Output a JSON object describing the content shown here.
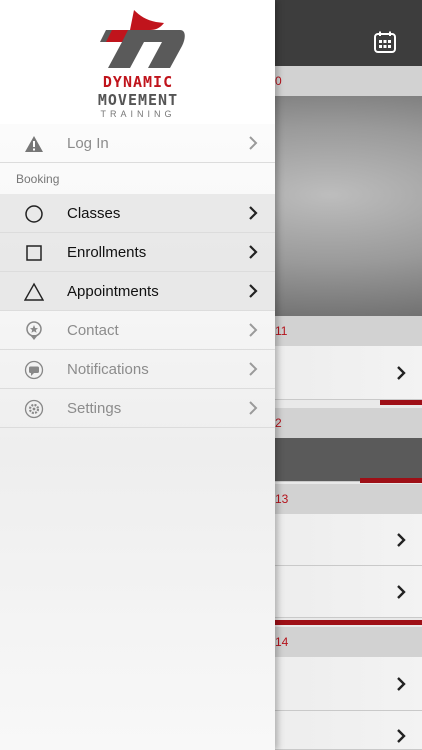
{
  "logo": {
    "line1": "DYNAMIC",
    "line2": "MOVEMENT",
    "line3": "TRAINING",
    "colors": {
      "red": "#c0141c",
      "gray": "#555555"
    }
  },
  "drawer": {
    "login": {
      "label": "Log In",
      "icon": "warning-icon"
    },
    "section_header": "Booking",
    "items": [
      {
        "label": "Classes",
        "icon": "circle-icon",
        "active": true
      },
      {
        "label": "Enrollments",
        "icon": "square-icon",
        "active": true
      },
      {
        "label": "Appointments",
        "icon": "triangle-icon",
        "active": true
      },
      {
        "label": "Contact",
        "icon": "star-badge-icon",
        "active": false
      },
      {
        "label": "Notifications",
        "icon": "chat-bubble-icon",
        "active": false
      },
      {
        "label": "Settings",
        "icon": "gear-icon",
        "active": false
      }
    ]
  },
  "background": {
    "date_labels": [
      "0",
      "11",
      "2",
      "13",
      "14"
    ],
    "accent": "#b5121b",
    "topbar_icon": "calendar-icon"
  }
}
